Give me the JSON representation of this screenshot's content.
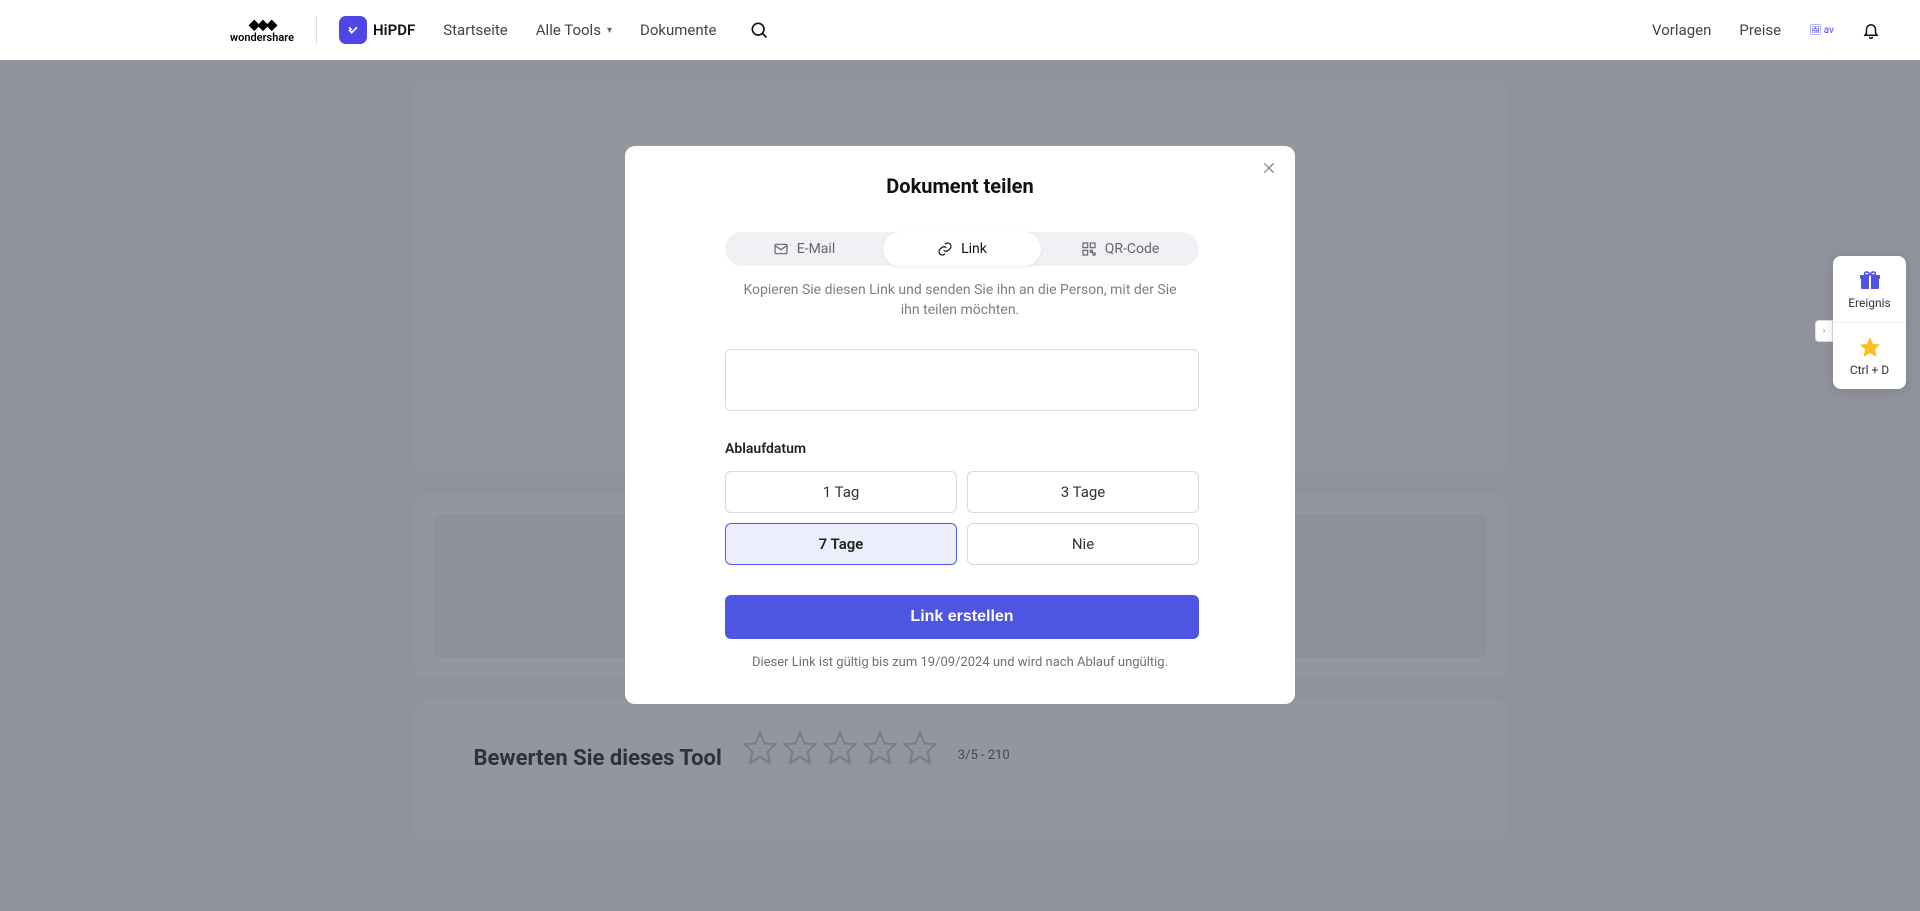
{
  "brand": {
    "wondershare": "wondershare",
    "hipdf": "HiPDF"
  },
  "nav": {
    "home": "Startseite",
    "all_tools": "Alle Tools",
    "documents": "Dokumente"
  },
  "header_right": {
    "templates": "Vorlagen",
    "pricing": "Preise",
    "avatar_alt": "av"
  },
  "bg": {
    "rate_title": "Bewerten Sie dieses Tool",
    "rate_score": "3/5 - 210"
  },
  "modal": {
    "title": "Dokument teilen",
    "tabs": {
      "email": "E-Mail",
      "link": "Link",
      "qr": "QR-Code"
    },
    "desc": "Kopieren Sie diesen Link und senden Sie ihn an die Person, mit der Sie ihn teilen möchten.",
    "expiry_label": "Ablaufdatum",
    "expiry": {
      "d1": "1 Tag",
      "d3": "3 Tage",
      "d7": "7 Tage",
      "never": "Nie"
    },
    "create_btn": "Link erstellen",
    "validity": "Dieser Link ist gültig bis zum 19/09/2024 und wird nach Ablauf ungültig."
  },
  "side": {
    "event": "Ereignis",
    "bookmark": "Ctrl + D"
  }
}
